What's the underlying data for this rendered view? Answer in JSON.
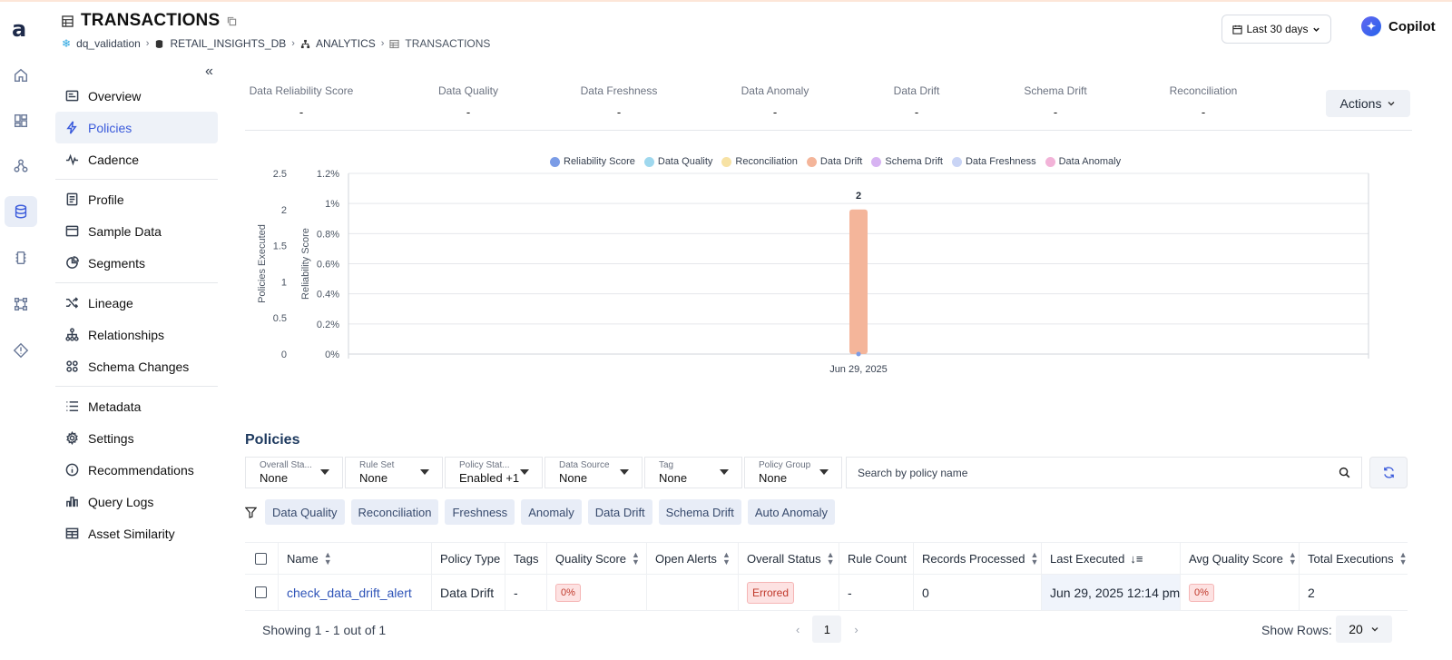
{
  "header": {
    "title": "TRANSACTIONS",
    "breadcrumbs": [
      "dq_validation",
      "RETAIL_INSIGHTS_DB",
      "ANALYTICS",
      "TRANSACTIONS"
    ],
    "date_range": "Last 30 days",
    "copilot_label": "Copilot"
  },
  "sidebar": {
    "items": [
      {
        "label": "Overview",
        "icon": "overview-icon"
      },
      {
        "label": "Policies",
        "icon": "bolt-icon",
        "active": true
      },
      {
        "label": "Cadence",
        "icon": "pulse-icon"
      },
      {
        "label": "Profile",
        "icon": "profile-icon"
      },
      {
        "label": "Sample Data",
        "icon": "sample-data-icon"
      },
      {
        "label": "Segments",
        "icon": "pie-icon"
      },
      {
        "label": "Lineage",
        "icon": "shuffle-icon"
      },
      {
        "label": "Relationships",
        "icon": "hierarchy-icon"
      },
      {
        "label": "Schema Changes",
        "icon": "grid-dots-icon"
      },
      {
        "label": "Metadata",
        "icon": "list-icon"
      },
      {
        "label": "Settings",
        "icon": "gear-icon"
      },
      {
        "label": "Recommendations",
        "icon": "info-icon"
      },
      {
        "label": "Query Logs",
        "icon": "bar-chart-icon"
      },
      {
        "label": "Asset Similarity",
        "icon": "table-icon"
      }
    ]
  },
  "metrics": [
    {
      "label": "Data Reliability Score",
      "value": "-"
    },
    {
      "label": "Data Quality",
      "value": "-"
    },
    {
      "label": "Data Freshness",
      "value": "-"
    },
    {
      "label": "Data Anomaly",
      "value": "-"
    },
    {
      "label": "Data Drift",
      "value": "-"
    },
    {
      "label": "Schema Drift",
      "value": "-"
    },
    {
      "label": "Reconciliation",
      "value": "-"
    }
  ],
  "actions_label": "Actions",
  "chart_data": {
    "type": "bar",
    "legend": [
      {
        "name": "Reliability Score",
        "color": "#7b9ce6"
      },
      {
        "name": "Data Quality",
        "color": "#9fd8ee"
      },
      {
        "name": "Reconciliation",
        "color": "#f7e2a4"
      },
      {
        "name": "Data Drift",
        "color": "#f4b59a"
      },
      {
        "name": "Schema Drift",
        "color": "#d7b3f2"
      },
      {
        "name": "Data Freshness",
        "color": "#c9d4f5"
      },
      {
        "name": "Data Anomaly",
        "color": "#f2b3d8"
      }
    ],
    "categories": [
      "Jun 29, 2025"
    ],
    "series": [
      {
        "name": "Data Drift",
        "values": [
          2
        ],
        "color": "#f4b59a"
      },
      {
        "name": "Reliability Score",
        "values": [
          0
        ],
        "color": "#7b9ce6"
      }
    ],
    "data_labels": [
      "2"
    ],
    "ylabel_left": "Policies Executed",
    "ylabel_right": "Reliability Score",
    "ylim_left": [
      0,
      2.5
    ],
    "left_ticks": [
      "0",
      "0.5",
      "1",
      "1.5",
      "2",
      "2.5"
    ],
    "ylim_right": [
      0,
      1.2
    ],
    "right_ticks": [
      "0%",
      "0.2%",
      "0.4%",
      "0.6%",
      "0.8%",
      "1%",
      "1.2%"
    ],
    "grid": true,
    "legend_position": "top"
  },
  "policies": {
    "title": "Policies",
    "filters": [
      {
        "label": "Overall Sta...",
        "value": "None"
      },
      {
        "label": "Rule Set",
        "value": "None"
      },
      {
        "label": "Policy Stat...",
        "value": "Enabled +1"
      },
      {
        "label": "Data Source",
        "value": "None"
      },
      {
        "label": "Tag",
        "value": "None"
      },
      {
        "label": "Policy Group",
        "value": "None"
      }
    ],
    "search_placeholder": "Search by policy name",
    "chips": [
      "Data Quality",
      "Reconciliation",
      "Freshness",
      "Anomaly",
      "Data Drift",
      "Schema Drift",
      "Auto Anomaly"
    ],
    "columns": [
      "Name",
      "Policy Type",
      "Tags",
      "Quality Score",
      "Open Alerts",
      "Overall Status",
      "Rule Count",
      "Records Processed",
      "Last Executed",
      "Avg Quality Score",
      "Total Executions"
    ],
    "rows": [
      {
        "name": "check_data_drift_alert",
        "policy_type": "Data Drift",
        "tags": "-",
        "quality_score": "0%",
        "open_alerts": "",
        "overall_status": "Errored",
        "rule_count": "-",
        "records_processed": "0",
        "last_executed": "Jun 29, 2025 12:14 pm",
        "avg_quality_score": "0%",
        "total_executions": "2"
      }
    ],
    "showing": "Showing 1 - 1 out of 1",
    "page": "1",
    "show_rows_label": "Show Rows:",
    "show_rows_value": "20"
  }
}
